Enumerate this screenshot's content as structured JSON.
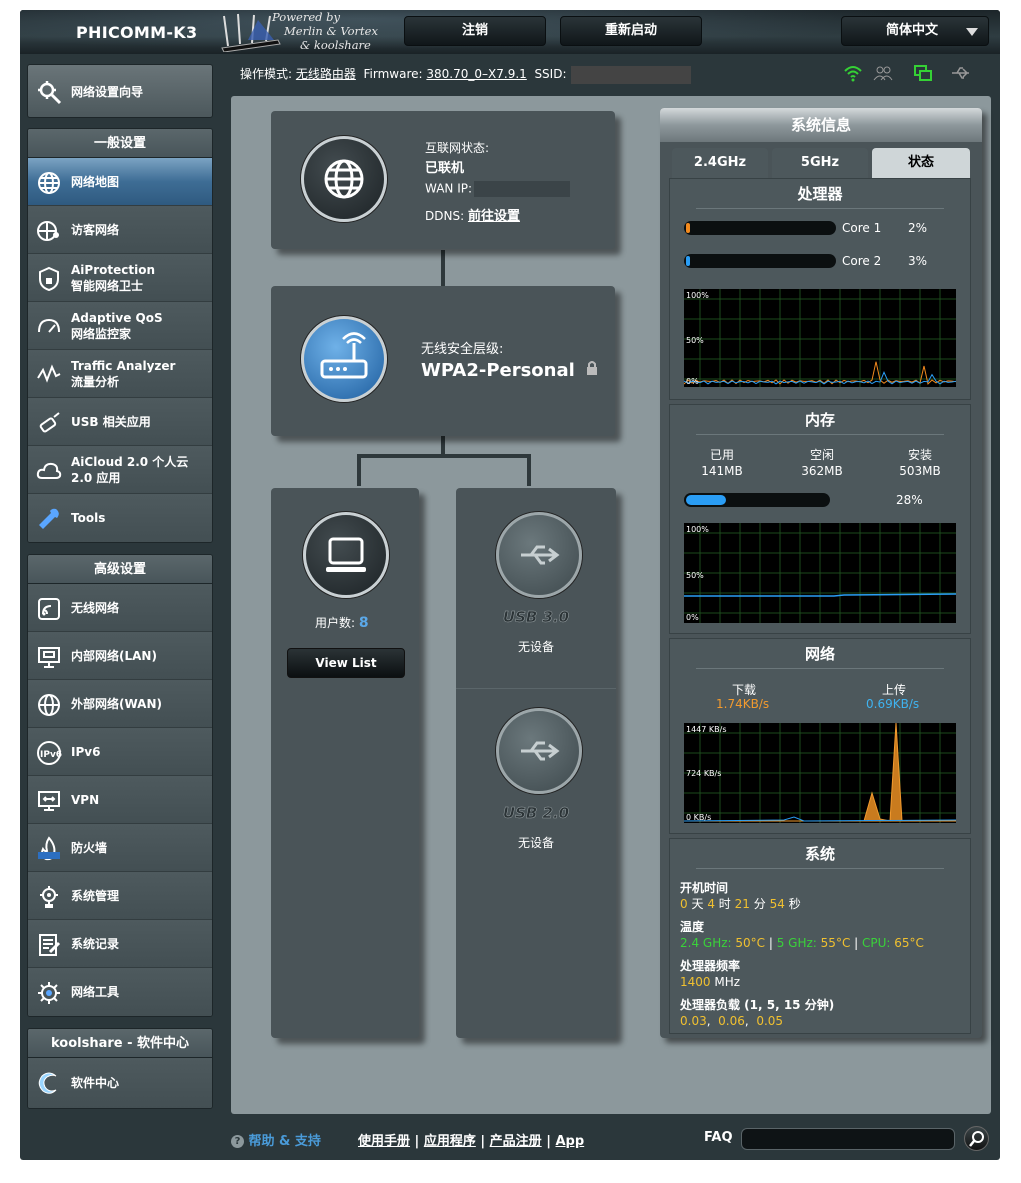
{
  "header": {
    "brand": "PHICOMM-K3",
    "powered": [
      "Powered by",
      "Merlin & Vortex",
      "& koolshare"
    ],
    "logout": "注销",
    "reboot": "重新启动",
    "language": "简体中文"
  },
  "statusline": {
    "mode_label": "操作模式:",
    "mode": "无线路由器",
    "fw_label": "Firmware:",
    "fw": "380.70_0–X7.9.1",
    "ssid_label": "SSID:"
  },
  "sidebar": {
    "wizard": "网络设置向导",
    "general_title": "一般设置",
    "general": [
      {
        "l1": "网络地图",
        "icon": "globe-icon"
      },
      {
        "l1": "访客网络",
        "icon": "guest-network-icon"
      },
      {
        "l1": "AiProtection",
        "l2": "智能网络卫士",
        "icon": "shield-icon"
      },
      {
        "l1": "Adaptive QoS",
        "l2": "网络监控家",
        "icon": "speedometer-icon"
      },
      {
        "l1": "Traffic Analyzer",
        "l2": "流量分析",
        "icon": "traffic-icon"
      },
      {
        "l1": "USB 相关应用",
        "icon": "usb-icon"
      },
      {
        "l1": "AiCloud 2.0 个人云",
        "l2": "2.0 应用",
        "icon": "cloud-icon"
      },
      {
        "l1": "Tools",
        "icon": "wrench-icon"
      }
    ],
    "advanced_title": "高级设置",
    "advanced": [
      {
        "l1": "无线网络",
        "icon": "wireless-icon"
      },
      {
        "l1": "内部网络(LAN)",
        "icon": "lan-icon"
      },
      {
        "l1": "外部网络(WAN)",
        "icon": "wan-globe-icon"
      },
      {
        "l1": "IPv6",
        "icon": "ipv6-icon"
      },
      {
        "l1": "VPN",
        "icon": "vpn-icon"
      },
      {
        "l1": "防火墙",
        "icon": "firewall-icon"
      },
      {
        "l1": "系统管理",
        "icon": "admin-gear-icon"
      },
      {
        "l1": "系统记录",
        "icon": "log-icon"
      },
      {
        "l1": "网络工具",
        "icon": "network-tools-icon"
      }
    ],
    "kool_title": "koolshare - 软件中心",
    "kool": [
      {
        "l1": "软件中心",
        "icon": "software-center-icon"
      }
    ]
  },
  "map": {
    "internet_label": "互联网状态:",
    "internet_status": "已联机",
    "wan_ip_label": "WAN IP:",
    "ddns_label": "DDNS:",
    "ddns_value": "前往设置",
    "security_label": "无线安全层级:",
    "security_value": "WPA2-Personal",
    "clients_label": "用户数:",
    "clients_value": "8",
    "view_list": "View List",
    "usb3": "USB 3.0",
    "usb3_status": "无设备",
    "usb2": "USB 2.0",
    "usb2_status": "无设备"
  },
  "sysinfo": {
    "title": "系统信息",
    "tabs": [
      "2.4GHz",
      "5GHz",
      "状态"
    ],
    "cpu_title": "处理器",
    "cores": [
      {
        "name": "Core 1",
        "pct": "2%",
        "value": 2,
        "color": "#f28a1e"
      },
      {
        "name": "Core 2",
        "pct": "3%",
        "value": 3,
        "color": "#2a9df4"
      }
    ],
    "axis_pct": [
      "100%",
      "50%",
      "0%"
    ],
    "mem_title": "内存",
    "mem": [
      {
        "label": "已用",
        "value": "141MB"
      },
      {
        "label": "空闲",
        "value": "362MB"
      },
      {
        "label": "安装",
        "value": "503MB"
      }
    ],
    "mem_pct": "28%",
    "mem_value": 28,
    "net_title": "网络",
    "net_down_label": "下载",
    "net_down": "1.74KB/s",
    "net_up_label": "上传",
    "net_up": "0.69KB/s",
    "net_axis": [
      "1447 KB/s",
      "724 KB/s",
      "0 KB/s"
    ],
    "sys_title": "系统",
    "uptime_title": "开机时间",
    "uptime": {
      "d": "0",
      "d_unit": "天",
      "h": "4",
      "h_unit": "时",
      "m": "21",
      "m_unit": "分",
      "s": "54",
      "s_unit": "秒"
    },
    "temp_title": "温度",
    "temp": {
      "t24_label": "2.4 GHz:",
      "t24": "50°C",
      "t5_label": "5 GHz:",
      "t5": "55°C",
      "cpu_label": "CPU:",
      "cpu": "65°C"
    },
    "freq_title": "处理器频率",
    "freq": "1400",
    "freq_unit": "MHz",
    "load_title": "处理器负载 (1, 5, 15 分钟)",
    "load": [
      "0.03",
      "0.06",
      "0.05"
    ]
  },
  "footer": {
    "help": "帮助 & 支持",
    "links": [
      "使用手册",
      "应用程序",
      "产品注册",
      "App"
    ],
    "faq": "FAQ"
  }
}
